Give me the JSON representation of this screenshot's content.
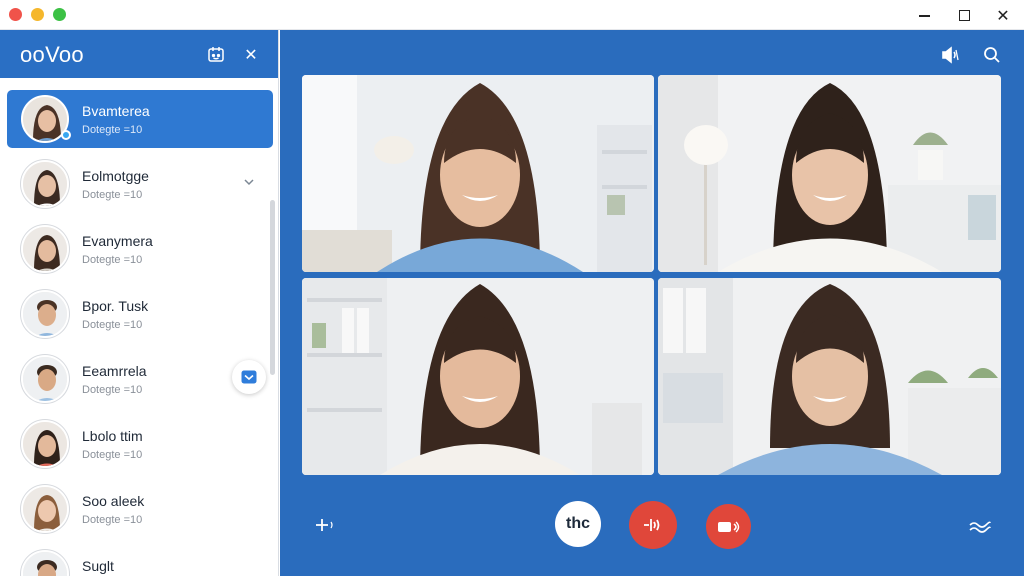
{
  "window": {
    "controls": [
      "minimize",
      "maximize",
      "close"
    ]
  },
  "sidebar": {
    "logo": "ooVoo",
    "contacts": [
      {
        "name": "Bvamterea",
        "status": "Dotegte =10"
      },
      {
        "name": "Eolmotgge",
        "status": "Dotegte =10"
      },
      {
        "name": "Evanymera",
        "status": "Dotegte =10"
      },
      {
        "name": "Bpor. Tusk",
        "status": "Dotegte =10"
      },
      {
        "name": "Eeamrrela",
        "status": "Dotegte =10"
      },
      {
        "name": "Lbolo ttim",
        "status": "Dotegte =10"
      },
      {
        "name": "Soo aleek",
        "status": "Dotegte =10"
      },
      {
        "name": "Suglt",
        "status": ""
      }
    ]
  },
  "controls": {
    "chat_label": "thc"
  },
  "colors": {
    "brand_blue": "#2a6cbd",
    "active_row": "#2f79d2",
    "end_call_red": "#e0473a"
  },
  "icons": [
    "calendar-icon",
    "close-icon",
    "chevron-down-icon",
    "audio-icon",
    "search-icon",
    "add-icon",
    "mic-icon",
    "end-call-icon",
    "more-icon"
  ]
}
